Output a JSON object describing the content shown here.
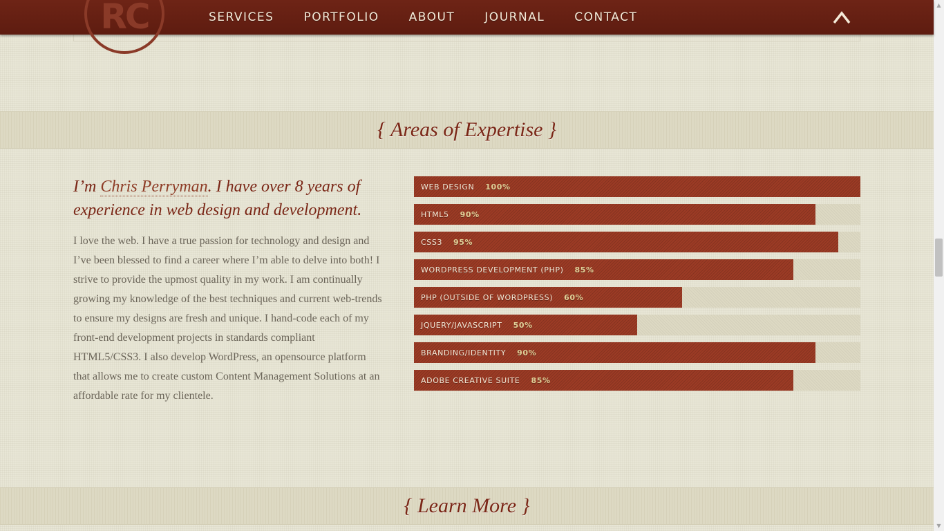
{
  "nav": {
    "logo_text": "RC",
    "links": [
      "SERVICES",
      "PORTFOLIO",
      "ABOUT",
      "JOURNAL",
      "CONTACT"
    ],
    "back_to_top_icon": "caret-up-icon"
  },
  "expertise": {
    "title": "{ Areas of Expertise }",
    "lead_prefix": "I’m ",
    "lead_name": "Chris Perryman",
    "lead_suffix": ". I have over 8 years of experience in web design and development.",
    "body": "I love the web. I have a true passion for technology and design and I’ve been blessed to find a career where I’m able to delve into both! I strive to provide the upmost quality in my work. I am continually growing my knowledge of the best techniques and current web-trends to ensure my designs are fresh and unique. I hand-code each of my front-end development projects in standards compliant HTML5/CSS3. I also develop WordPress, an opensource platform that allows me to create custom Content Management Solutions at an affordable rate for my clientele.",
    "skills": [
      {
        "label": "WEB DESIGN",
        "percent_text": "100%",
        "value": 100
      },
      {
        "label": "HTML5",
        "percent_text": "90%",
        "value": 90
      },
      {
        "label": "CSS3",
        "percent_text": "95%",
        "value": 95
      },
      {
        "label": "WORDPRESS DEVELOPMENT (PHP)",
        "percent_text": "85%",
        "value": 85
      },
      {
        "label": "PHP (OUTSIDE OF WORDPRESS)",
        "percent_text": "60%",
        "value": 60
      },
      {
        "label": "JQUERY/JAVASCRIPT",
        "percent_text": "50%",
        "value": 50
      },
      {
        "label": "BRANDING/IDENTITY",
        "percent_text": "90%",
        "value": 90
      },
      {
        "label": "ADOBE CREATIVE SUITE",
        "percent_text": "85%",
        "value": 85
      }
    ]
  },
  "learn_more": {
    "title": "{ Learn More }"
  },
  "colors": {
    "brand": "#7a2616",
    "bar_fill": "#9c3b25",
    "nav_bg": "#6e2416",
    "background": "#e8e6d6"
  }
}
